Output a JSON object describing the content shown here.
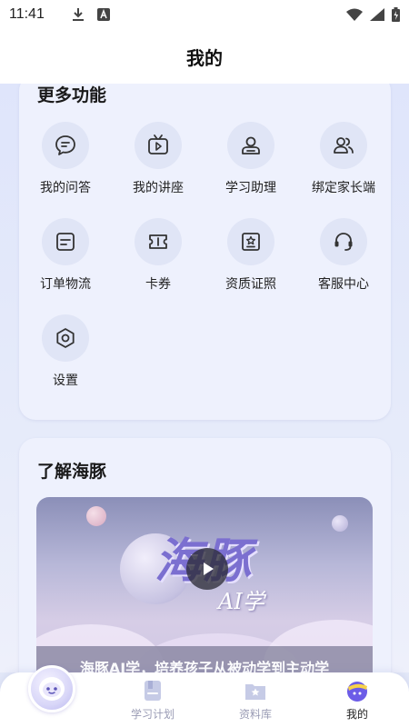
{
  "status_bar": {
    "time": "11:41"
  },
  "header": {
    "title": "我的"
  },
  "more_features": {
    "title": "更多功能",
    "items": [
      {
        "label": "我的问答",
        "icon": "chat-bubble-icon"
      },
      {
        "label": "我的讲座",
        "icon": "tv-play-icon"
      },
      {
        "label": "学习助理",
        "icon": "assistant-person-icon"
      },
      {
        "label": "绑定家长端",
        "icon": "users-icon"
      },
      {
        "label": "订单物流",
        "icon": "order-list-icon"
      },
      {
        "label": "卡券",
        "icon": "ticket-icon"
      },
      {
        "label": "资质证照",
        "icon": "certificate-icon"
      },
      {
        "label": "客服中心",
        "icon": "headset-icon"
      },
      {
        "label": "设置",
        "icon": "gear-icon"
      }
    ]
  },
  "about": {
    "title": "了解海豚",
    "video": {
      "brand_title": "海豚",
      "brand_subtitle": "AI学",
      "caption": "海豚AI学，培养孩子从被动学到主动学"
    }
  },
  "bottom_nav": {
    "items": [
      {
        "label": "学习计划",
        "icon": "study-plan-icon",
        "active": false
      },
      {
        "label": "资料库",
        "icon": "library-icon",
        "active": false
      },
      {
        "label": "我的",
        "icon": "profile-icon",
        "active": true
      }
    ]
  },
  "colors": {
    "accent": "#6c5ce7",
    "card_bg": "#eef1fd",
    "icon_circle_bg": "#e0e5f6",
    "nav_inactive": "#9a9cb5"
  }
}
